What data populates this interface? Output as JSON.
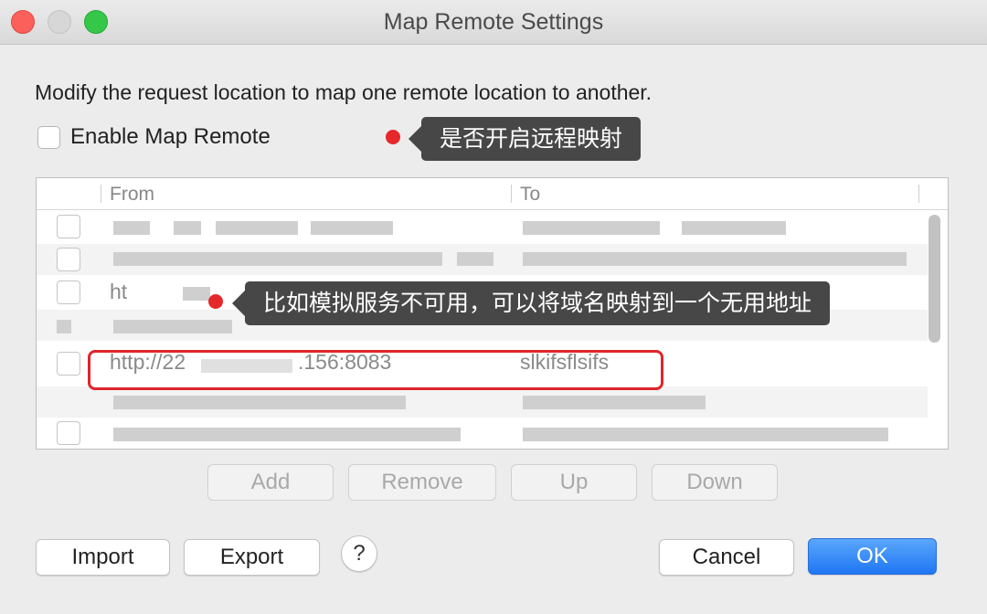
{
  "window": {
    "title": "Map Remote Settings",
    "controls": [
      "close",
      "minimize",
      "zoom"
    ]
  },
  "description": "Modify the request location to map one remote location to another.",
  "enable_map_remote": {
    "label": "Enable Map Remote",
    "checked": false
  },
  "annotations": {
    "enable_tooltip": "是否开启远程映射",
    "example_tooltip": "比如模拟服务不可用，可以将域名映射到一个无用地址"
  },
  "table": {
    "columns": [
      "From",
      "To"
    ],
    "rows": [
      {
        "checked": false,
        "from": "",
        "to": ""
      },
      {
        "checked": false,
        "from": "",
        "to": ""
      },
      {
        "checked": false,
        "from": "ht",
        "to": ""
      },
      {
        "checked": false,
        "from": "",
        "to": ""
      },
      {
        "checked": false,
        "from": "http://22",
        "from_suffix": ".156:8083",
        "to": "slkifsflsifs",
        "highlighted": true
      },
      {
        "checked": false,
        "from": "",
        "to": ""
      },
      {
        "checked": false,
        "from": "",
        "to": ""
      }
    ]
  },
  "row_actions": {
    "add": "Add",
    "remove": "Remove",
    "up": "Up",
    "down": "Down"
  },
  "footer": {
    "import": "Import",
    "export": "Export",
    "help": "?",
    "cancel": "Cancel",
    "ok": "OK"
  },
  "colors": {
    "accent": "#1f76f2",
    "annotation_red": "#e0262b",
    "tooltip_bg": "#474747"
  },
  "icons": {
    "help": "question-mark-icon",
    "annotation_marker": "red-dot-icon"
  }
}
